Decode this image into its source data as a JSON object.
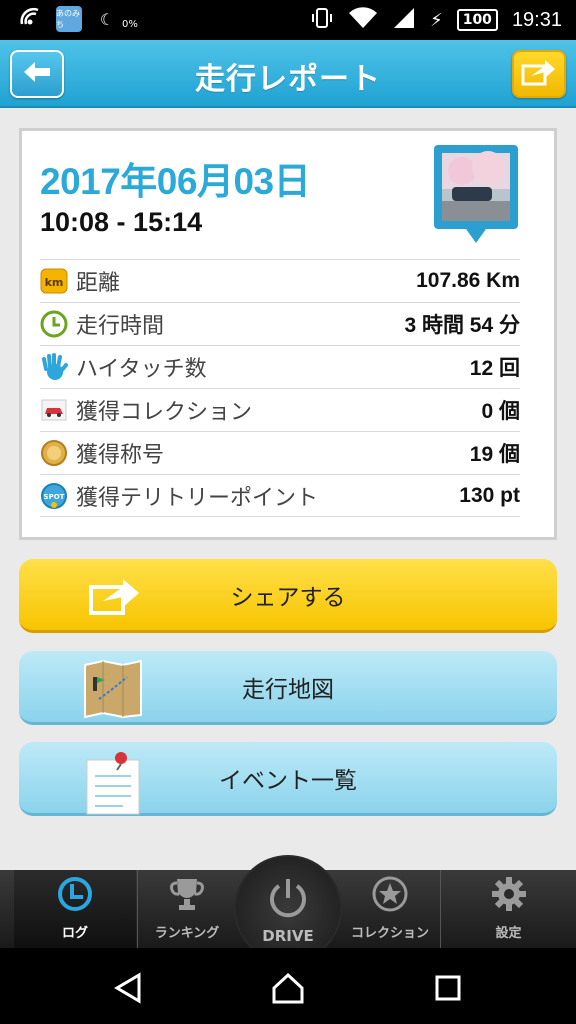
{
  "status_bar": {
    "app_badge": "あのみち",
    "percent": "0%",
    "battery": "100",
    "time": "19:31"
  },
  "header": {
    "title": "走行レポート"
  },
  "report": {
    "date": "2017年06月03日",
    "time_range": "10:08 - 15:14",
    "rows": [
      {
        "icon": "km-icon",
        "label": "距離",
        "value": "107.86 Km"
      },
      {
        "icon": "clock-icon",
        "label": "走行時間",
        "value": "3 時間 54 分"
      },
      {
        "icon": "hand-icon",
        "label": "ハイタッチ数",
        "value": "12 回"
      },
      {
        "icon": "car-icon",
        "label": "獲得コレクション",
        "value": "0 個"
      },
      {
        "icon": "medal-icon",
        "label": "獲得称号",
        "value": "19 個"
      },
      {
        "icon": "spot-icon",
        "label": "獲得テリトリーポイント",
        "value": "130 pt"
      }
    ]
  },
  "actions": {
    "share": "シェアする",
    "map": "走行地図",
    "events": "イベント一覧"
  },
  "tabs": {
    "log": "ログ",
    "ranking": "ランキング",
    "drive": "DRIVE",
    "collection": "コレクション",
    "settings": "設定"
  },
  "colors": {
    "header": "#1fa2d3",
    "accent_blue": "#2ba9d8",
    "share_yellow": "#f7c400",
    "light_blue": "#8bd3ec"
  }
}
